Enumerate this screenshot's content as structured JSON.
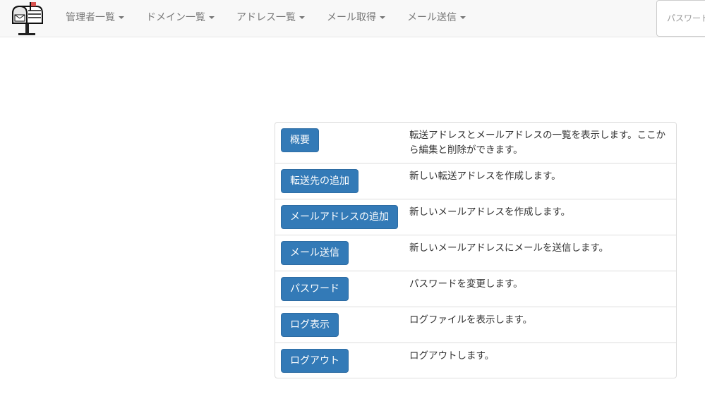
{
  "navbar": {
    "logo_icon": "mailbox-icon",
    "menus": [
      {
        "label": "管理者一覧"
      },
      {
        "label": "ドメイン一覧"
      },
      {
        "label": "アドレス一覧"
      },
      {
        "label": "メール取得"
      },
      {
        "label": "メール送信"
      }
    ],
    "password_placeholder": "パスワード"
  },
  "menu": {
    "rows": [
      {
        "button": "概要",
        "description": "転送アドレスとメールアドレスの一覧を表示します。ここから編集と削除ができます。"
      },
      {
        "button": "転送先の追加",
        "description": "新しい転送アドレスを作成します。"
      },
      {
        "button": "メールアドレスの追加",
        "description": "新しいメールアドレスを作成します。"
      },
      {
        "button": "メール送信",
        "description": "新しいメールアドレスにメールを送信します。"
      },
      {
        "button": "パスワード",
        "description": "パスワードを変更します。"
      },
      {
        "button": "ログ表示",
        "description": "ログファイルを表示します。"
      },
      {
        "button": "ログアウト",
        "description": "ログアウトします。"
      }
    ]
  },
  "colors": {
    "primary": "#337ab7",
    "navbar_bg": "#f8f8f8",
    "nav_text": "#777777"
  }
}
